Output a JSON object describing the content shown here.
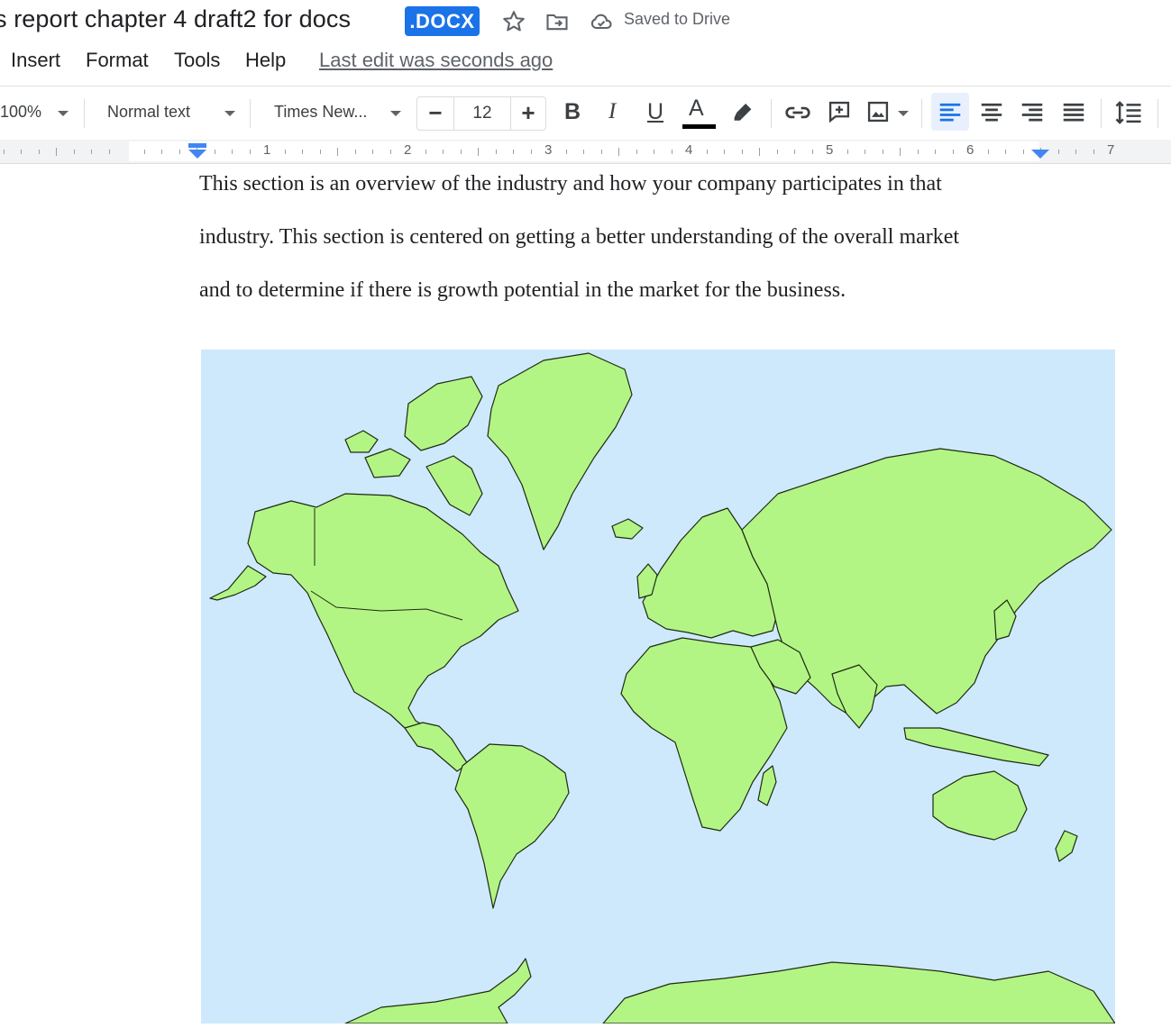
{
  "title_bar": {
    "doc_title": "s report chapter 4 draft2 for docs",
    "file_type_badge": ".DOCX",
    "saved_status": "Saved to Drive",
    "icons": [
      "star-icon",
      "move-to-folder-icon",
      "cloud-done-icon"
    ]
  },
  "menu": {
    "items": [
      "Insert",
      "Format",
      "Tools",
      "Help"
    ],
    "last_edit": "Last edit was seconds ago"
  },
  "toolbar": {
    "zoom": "100%",
    "paragraph_style": "Normal text",
    "font": "Times New...",
    "font_size": "12",
    "minus": "−",
    "plus": "+",
    "bold": "B",
    "italic": "I",
    "underline": "U",
    "text_color": "A",
    "text_color_value": "#000000",
    "active_alignment": "left",
    "icons": [
      "highlight-icon",
      "link-icon",
      "add-comment-icon",
      "insert-image-icon",
      "align-left-icon",
      "align-center-icon",
      "align-right-icon",
      "align-justify-icon",
      "line-spacing-icon"
    ]
  },
  "ruler": {
    "numbers": [
      "1",
      "2",
      "3",
      "4",
      "5",
      "6",
      "7"
    ]
  },
  "document": {
    "paragraph_lines": [
      "This section is an overview of the industry and how your company participates in that",
      "industry.  This section is centered on getting a better understanding of the overall market",
      "and to determine if there is growth potential in the market for the business."
    ],
    "image": "world-map",
    "colors": {
      "ocean": "#cde9fb",
      "land": "#b3f585",
      "accent": "#1a73e8"
    }
  }
}
